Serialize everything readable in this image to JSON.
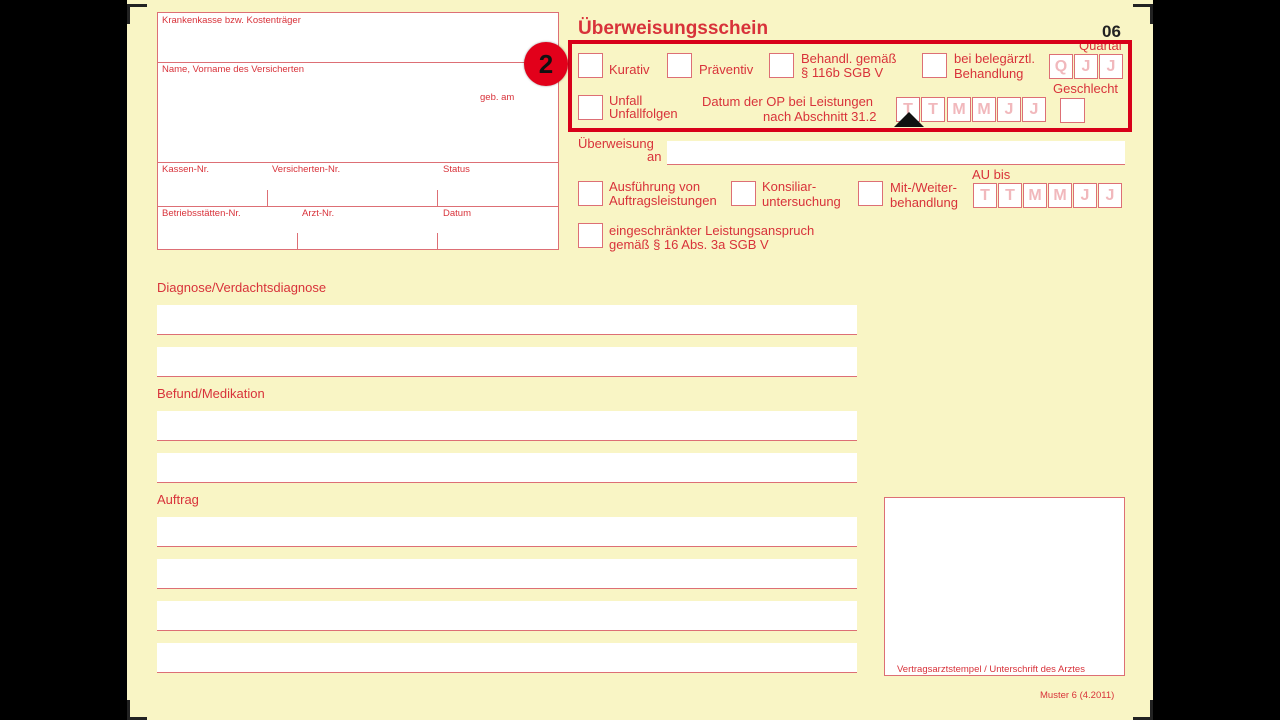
{
  "form": {
    "title": "Überweisungsschein",
    "form_code": "06",
    "footer_code": "Muster 6 (4.2011)"
  },
  "patient_box": {
    "insurer_label": "Krankenkasse bzw. Kostenträger",
    "name_label": "Name, Vorname des Versicherten",
    "dob_label": "geb. am",
    "kassen_nr_label": "Kassen-Nr.",
    "versicherten_nr_label": "Versicherten-Nr.",
    "status_label": "Status",
    "betriebsstaetten_nr_label": "Betriebsstätten-Nr.",
    "arzt_nr_label": "Arzt-Nr.",
    "datum_label": "Datum"
  },
  "options": {
    "kurativ": "Kurativ",
    "praeventiv": "Präventiv",
    "behandl_line1": "Behandl. gemäß",
    "behandl_line2": "§ 116b SGB V",
    "belegaerztl_line1": "bei belegärztl.",
    "belegaerztl_line2": "Behandlung",
    "quartal_label": "Quartal",
    "quartal_cells": [
      "Q",
      "J",
      "J"
    ],
    "unfall_line1": "Unfall",
    "unfall_line2": "Unfallfolgen",
    "op_date_line1": "Datum der OP bei Leistungen",
    "op_date_line2": "nach Abschnitt 31.2",
    "op_date_cells": [
      "T",
      "T",
      "M",
      "M",
      "J",
      "J"
    ],
    "geschlecht_label": "Geschlecht"
  },
  "referral": {
    "ueberweisung_line1": "Überweisung",
    "ueberweisung_line2": "an",
    "ausfuehrung_line1": "Ausführung von",
    "ausfuehrung_line2": "Auftragsleistungen",
    "konsiliar_line1": "Konsiliar-",
    "konsiliar_line2": "untersuchung",
    "mitweiter_line1": "Mit-/Weiter-",
    "mitweiter_line2": "behandlung",
    "au_bis_label": "AU bis",
    "au_cells": [
      "T",
      "T",
      "M",
      "M",
      "J",
      "J"
    ],
    "eingeschraenkt_line1": "eingeschränkter Leistungsanspruch",
    "eingeschraenkt_line2": "gemäß § 16 Abs. 3a SGB V"
  },
  "sections": {
    "diagnose": "Diagnose/Verdachtsdiagnose",
    "befund": "Befund/Medikation",
    "auftrag": "Auftrag"
  },
  "stamp": {
    "label": "Vertragsarztstempel / Unterschrift des Arztes"
  },
  "annotation": {
    "badge_number": "2",
    "highlight_color": "#d8001a"
  }
}
